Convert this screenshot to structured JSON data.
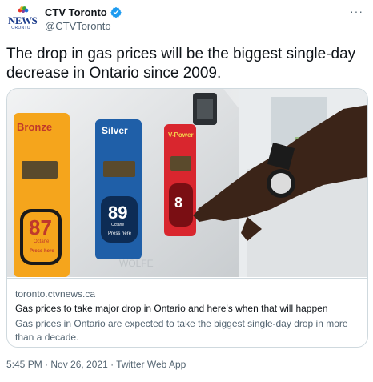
{
  "author": {
    "display_name": "CTV Toronto",
    "handle": "@CTVToronto",
    "avatar_text": "NEWS",
    "avatar_sub": "TORONTO"
  },
  "tweet": {
    "text": "The drop in gas prices will be the biggest single-day decrease in Ontario since 2009."
  },
  "card": {
    "domain": "toronto.ctvnews.ca",
    "title": "Gas prices to take major drop in Ontario and here's when that will happen",
    "description": "Gas prices in Ontario are expected to take the biggest single-day drop in more than a decade.",
    "image": {
      "bronze_label": "Bronze",
      "silver_label": "Silver",
      "vpower_label": "V-Power",
      "bronze_octane": "87",
      "silver_octane": "89",
      "vpower_octane": "8",
      "bronze_sub": "Octane",
      "silver_sub": "Octane",
      "bronze_cta": "Press here",
      "silver_cta": "Press here"
    }
  },
  "meta": {
    "timestamp": "5:45 PM · Nov 26, 2021 · Twitter Web App"
  },
  "colors": {
    "text": "#0f1419",
    "secondary": "#536471",
    "border": "#cfd9de",
    "verified": "#1d9bf0"
  }
}
